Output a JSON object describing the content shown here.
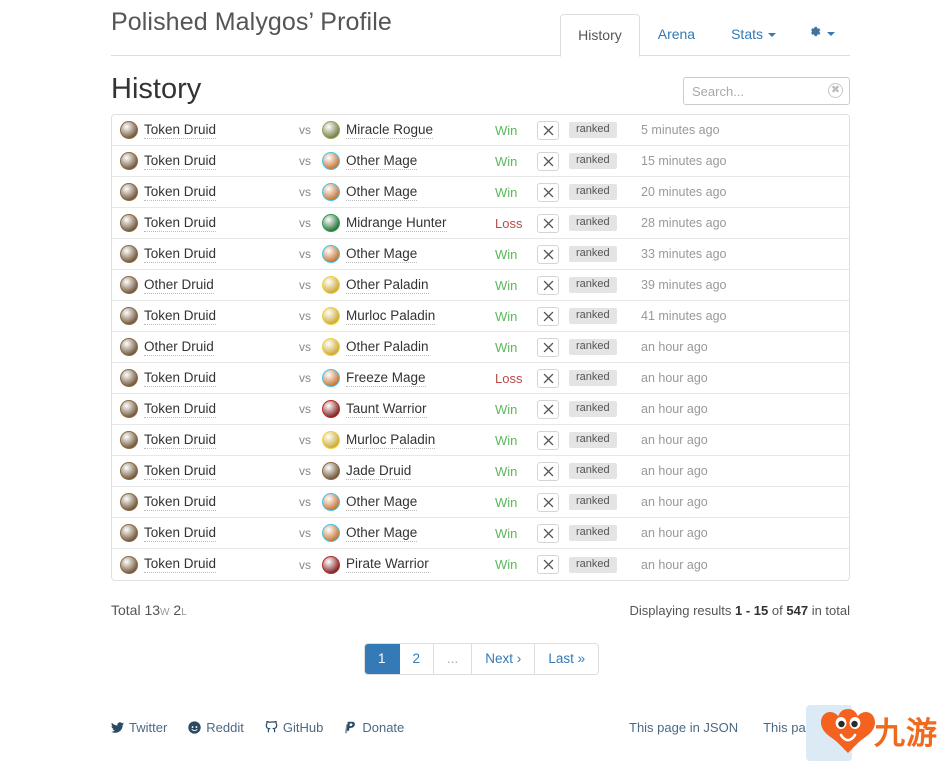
{
  "header": {
    "title": "Polished Malygos’ Profile",
    "tabs": [
      {
        "label": "History",
        "active": true,
        "caret": false
      },
      {
        "label": "Arena",
        "active": false,
        "caret": false
      },
      {
        "label": "Stats",
        "active": false,
        "caret": true
      }
    ],
    "settings_icon": "gear-icon"
  },
  "section": {
    "title": "History"
  },
  "search": {
    "placeholder": "Search...",
    "value": "",
    "clear_icon": "clear-circle-icon"
  },
  "table": {
    "vs_label": "vs",
    "swords_icon": "crossed-swords-icon",
    "rows": [
      {
        "hero_deck": "Token Druid",
        "hero_class": "druid",
        "opponent_deck": "Miracle Rogue",
        "opponent_class": "rogue",
        "result": "Win",
        "mode": "ranked",
        "time": "5 minutes ago"
      },
      {
        "hero_deck": "Token Druid",
        "hero_class": "druid",
        "opponent_deck": "Other Mage",
        "opponent_class": "mage",
        "result": "Win",
        "mode": "ranked",
        "time": "15 minutes ago"
      },
      {
        "hero_deck": "Token Druid",
        "hero_class": "druid",
        "opponent_deck": "Other Mage",
        "opponent_class": "mage",
        "result": "Win",
        "mode": "ranked",
        "time": "20 minutes ago"
      },
      {
        "hero_deck": "Token Druid",
        "hero_class": "druid",
        "opponent_deck": "Midrange Hunter",
        "opponent_class": "hunter",
        "result": "Loss",
        "mode": "ranked",
        "time": "28 minutes ago"
      },
      {
        "hero_deck": "Token Druid",
        "hero_class": "druid",
        "opponent_deck": "Other Mage",
        "opponent_class": "mage",
        "result": "Win",
        "mode": "ranked",
        "time": "33 minutes ago"
      },
      {
        "hero_deck": "Other Druid",
        "hero_class": "druid",
        "opponent_deck": "Other Paladin",
        "opponent_class": "paladin",
        "result": "Win",
        "mode": "ranked",
        "time": "39 minutes ago"
      },
      {
        "hero_deck": "Token Druid",
        "hero_class": "druid",
        "opponent_deck": "Murloc Paladin",
        "opponent_class": "paladin",
        "result": "Win",
        "mode": "ranked",
        "time": "41 minutes ago"
      },
      {
        "hero_deck": "Other Druid",
        "hero_class": "druid",
        "opponent_deck": "Other Paladin",
        "opponent_class": "paladin",
        "result": "Win",
        "mode": "ranked",
        "time": "an hour ago"
      },
      {
        "hero_deck": "Token Druid",
        "hero_class": "druid",
        "opponent_deck": "Freeze Mage",
        "opponent_class": "mage",
        "result": "Loss",
        "mode": "ranked",
        "time": "an hour ago"
      },
      {
        "hero_deck": "Token Druid",
        "hero_class": "druid",
        "opponent_deck": "Taunt Warrior",
        "opponent_class": "warrior",
        "result": "Win",
        "mode": "ranked",
        "time": "an hour ago"
      },
      {
        "hero_deck": "Token Druid",
        "hero_class": "druid",
        "opponent_deck": "Murloc Paladin",
        "opponent_class": "paladin",
        "result": "Win",
        "mode": "ranked",
        "time": "an hour ago"
      },
      {
        "hero_deck": "Token Druid",
        "hero_class": "druid",
        "opponent_deck": "Jade Druid",
        "opponent_class": "druid",
        "result": "Win",
        "mode": "ranked",
        "time": "an hour ago"
      },
      {
        "hero_deck": "Token Druid",
        "hero_class": "druid",
        "opponent_deck": "Other Mage",
        "opponent_class": "mage",
        "result": "Win",
        "mode": "ranked",
        "time": "an hour ago"
      },
      {
        "hero_deck": "Token Druid",
        "hero_class": "druid",
        "opponent_deck": "Other Mage",
        "opponent_class": "mage",
        "result": "Win",
        "mode": "ranked",
        "time": "an hour ago"
      },
      {
        "hero_deck": "Token Druid",
        "hero_class": "druid",
        "opponent_deck": "Pirate Warrior",
        "opponent_class": "warrior",
        "result": "Win",
        "mode": "ranked",
        "time": "an hour ago"
      }
    ]
  },
  "summary": {
    "total_label": "Total",
    "wins": "13",
    "wins_suffix": "W",
    "losses": "2",
    "losses_suffix": "L",
    "displaying_prefix": "Displaying results",
    "range": "1 - 15",
    "of_label": "of",
    "total_count": "547",
    "in_total_label": "in total"
  },
  "pagination": {
    "pages": [
      {
        "label": "1",
        "active": true
      },
      {
        "label": "2",
        "active": false
      },
      {
        "label": "...",
        "active": false,
        "ellipsis": true
      },
      {
        "label": "Next ›",
        "active": false
      },
      {
        "label": "Last »",
        "active": false
      }
    ]
  },
  "footer": {
    "left_links": [
      {
        "label": "Twitter",
        "icon": "twitter-icon"
      },
      {
        "label": "Reddit",
        "icon": "reddit-icon"
      },
      {
        "label": "GitHub",
        "icon": "github-icon"
      },
      {
        "label": "Donate",
        "icon": "paypal-icon"
      }
    ],
    "right_links": [
      {
        "label": "This page in JSON"
      },
      {
        "label": "This page in"
      }
    ]
  },
  "watermark": {
    "text": "九游",
    "mascot_icon": "mascot-blob-icon",
    "accent_color": "#f06a1e"
  },
  "colors": {
    "win": "#5cb85c",
    "loss": "#b94a48",
    "link": "#337ab7",
    "active_page_bg": "#337ab7",
    "badge_bg": "#e4e4e4",
    "class_druid": "#7a5c3e",
    "class_rogue": "#8a9150",
    "class_mage": "#4fc3e8",
    "class_hunter": "#2f9e44",
    "class_paladin": "#e8c93a",
    "class_warrior": "#b02a2a"
  }
}
